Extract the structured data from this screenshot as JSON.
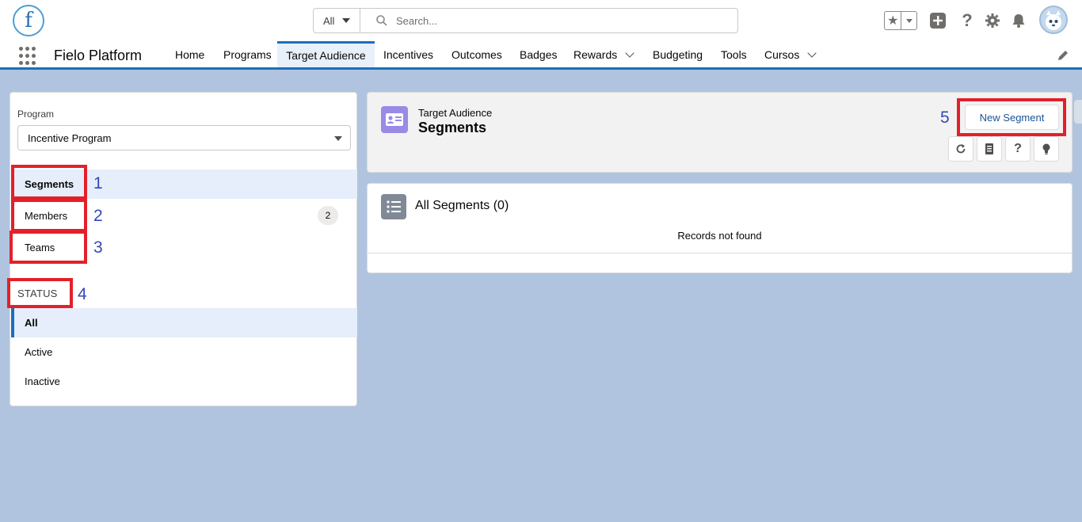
{
  "global_header": {
    "logo_letter": "f",
    "search": {
      "scope": "All",
      "placeholder": "Search..."
    },
    "icons": [
      "favorites-star-icon",
      "add-icon",
      "help-icon",
      "setup-gear-icon",
      "notifications-bell-icon",
      "user-avatar"
    ]
  },
  "nav": {
    "app_name": "Fielo Platform",
    "items": [
      {
        "label": "Home"
      },
      {
        "label": "Programs"
      },
      {
        "label": "Target Audience",
        "active": true
      },
      {
        "label": "Incentives"
      },
      {
        "label": "Outcomes"
      },
      {
        "label": "Badges"
      },
      {
        "label": "Rewards",
        "has_dropdown": true
      },
      {
        "label": "Budgeting"
      },
      {
        "label": "Tools"
      },
      {
        "label": "Cursos",
        "has_dropdown": true
      }
    ]
  },
  "left_panel": {
    "program_label": "Program",
    "program_value": "Incentive Program",
    "menu": [
      {
        "label": "Segments",
        "selected": true
      },
      {
        "label": "Members",
        "count": "2"
      },
      {
        "label": "Teams"
      }
    ],
    "status_heading": "STATUS",
    "status_filters": [
      {
        "label": "All",
        "selected": true
      },
      {
        "label": "Active"
      },
      {
        "label": "Inactive"
      }
    ]
  },
  "annotations": [
    "1",
    "2",
    "3",
    "4",
    "5"
  ],
  "page_header": {
    "object_label": "Target Audience",
    "title": "Segments",
    "new_button": "New Segment",
    "icon_buttons": [
      "refresh-icon",
      "notebook-icon",
      "help-icon",
      "lightbulb-icon"
    ]
  },
  "list": {
    "title": "All Segments (0)",
    "empty_message": "Records not found"
  },
  "colors": {
    "brand_blue": "#1b6fbb",
    "highlight_red": "#e3202a",
    "annotation_blue": "#3548b8",
    "background": "#b0c4df",
    "object_icon": "#9a8ae6"
  }
}
